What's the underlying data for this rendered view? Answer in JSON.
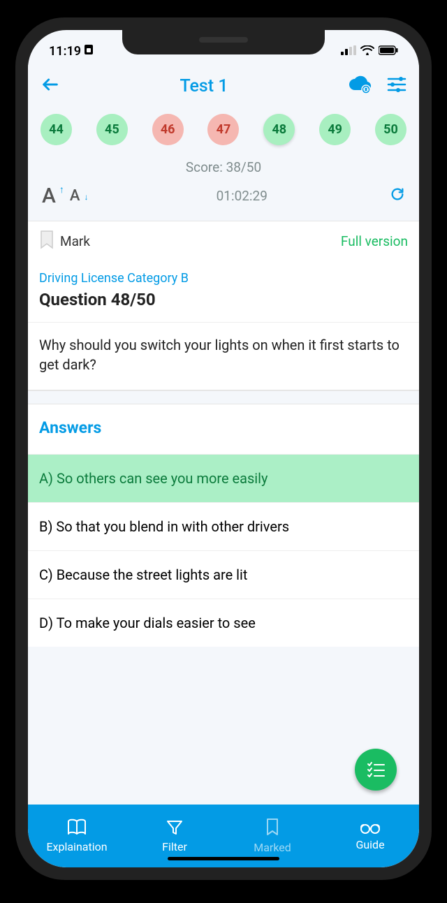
{
  "status": {
    "time": "11:19"
  },
  "header": {
    "title": "Test 1"
  },
  "questions": [
    {
      "n": "44",
      "state": "correct"
    },
    {
      "n": "45",
      "state": "correct"
    },
    {
      "n": "46",
      "state": "wrong"
    },
    {
      "n": "47",
      "state": "wrong"
    },
    {
      "n": "48",
      "state": "correct",
      "current": true
    },
    {
      "n": "49",
      "state": "correct"
    },
    {
      "n": "50",
      "state": "correct"
    }
  ],
  "score_label": "Score: 38/50",
  "timer": "01:02:29",
  "mark_label": "Mark",
  "full_version_label": "Full version",
  "category": "Driving License Category B",
  "question_title": "Question 48/50",
  "question_text": "Why should you switch your lights on when it first starts to get dark?",
  "answers_heading": "Answers",
  "answers": [
    {
      "text": "A) So others can see you more easily",
      "correct": true
    },
    {
      "text": "B) So that you blend in with other drivers"
    },
    {
      "text": "C) Because the street lights are lit"
    },
    {
      "text": "D) To make your dials easier to see"
    }
  ],
  "nav": {
    "explain": "Explaination",
    "filter": "Filter",
    "marked": "Marked",
    "guide": "Guide"
  },
  "colors": {
    "primary": "#039be5",
    "success": "#1abc62",
    "correct_bg": "#abefc6",
    "correct_text": "#0a7a3b",
    "wrong_bg": "#f5b7b1",
    "wrong_text": "#c0392b"
  }
}
